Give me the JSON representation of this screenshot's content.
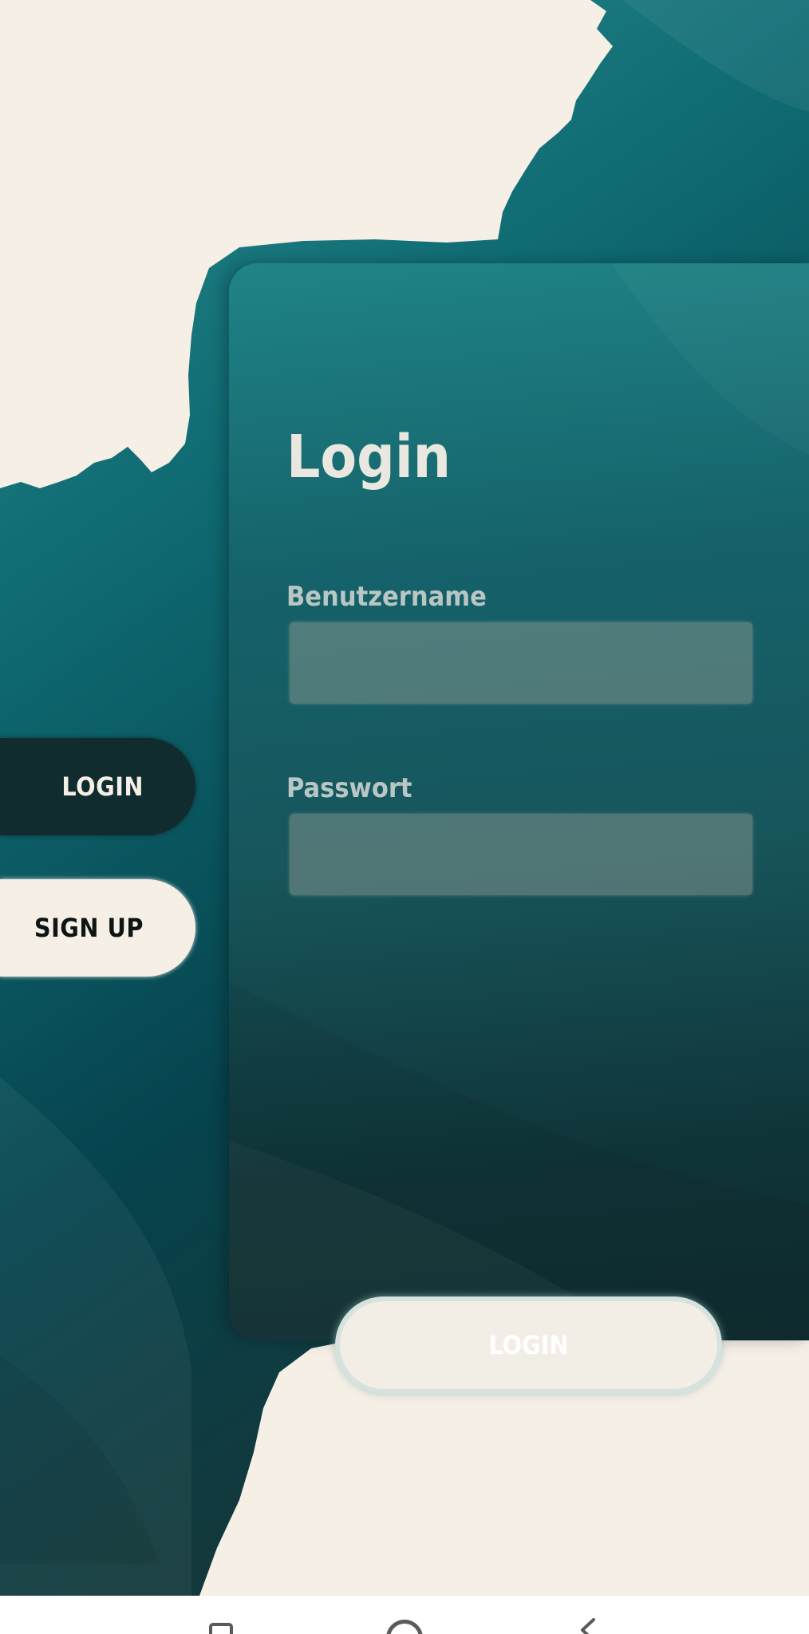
{
  "nav": {
    "login_label": "LOGIN",
    "signup_label": "SIGN UP"
  },
  "card": {
    "title": "Login",
    "username_label": "Benutzername",
    "username_value": "",
    "password_label": "Passwort",
    "password_value": "",
    "submit_label": "LOGIN"
  },
  "system_nav": {
    "recents_icon": "recents-icon",
    "home_icon": "home-circle-icon",
    "back_icon": "back-chevron-icon"
  },
  "colors": {
    "cream": "#f5efe6",
    "teal": "#1f8486",
    "dark_teal": "#102c2e",
    "label_gray": "#b8c6c4"
  }
}
